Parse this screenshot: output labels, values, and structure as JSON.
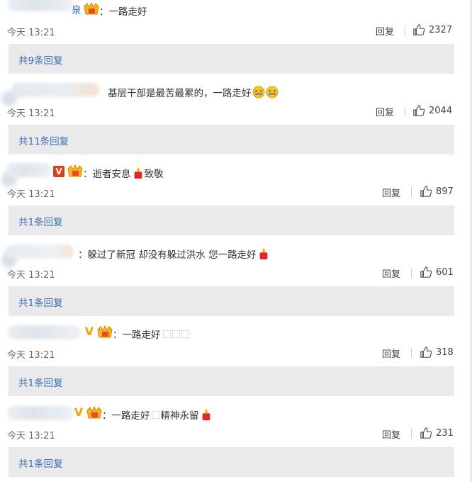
{
  "comments": [
    {
      "name_fragment": "泉",
      "content": "一路走好",
      "time": "今天 13:21",
      "reply_label": "回复",
      "likes": "2327",
      "replies_link": "共9条回复"
    },
    {
      "content": "基层干部是最苦最累的，一路走好",
      "time": "今天 13:21",
      "reply_label": "回复",
      "likes": "2044",
      "replies_link": "共11条回复"
    },
    {
      "content_a": "逝者安息",
      "content_b": "致敬",
      "time": "今天 13:21",
      "reply_label": "回复",
      "likes": "897",
      "replies_link": "共1条回复"
    },
    {
      "content": "躲过了新冠 却没有躲过洪水 您一路走好",
      "time": "今天 13:21",
      "reply_label": "回复",
      "likes": "601",
      "replies_link": "共1条回复"
    },
    {
      "content": "一路走好",
      "time": "今天 13:21",
      "reply_label": "回复",
      "likes": "318",
      "replies_link": "共1条回复"
    },
    {
      "content_a": "一路走好",
      "content_b": "精神永留",
      "time": "今天 13:21",
      "reply_label": "回复",
      "likes": "231",
      "replies_link": "共1条回复"
    }
  ],
  "vip_badge": "V",
  "colon": "：",
  "colors": {
    "link": "#3a6fb0",
    "reply_box": "#eaeaec",
    "vip": "#f0a000"
  }
}
